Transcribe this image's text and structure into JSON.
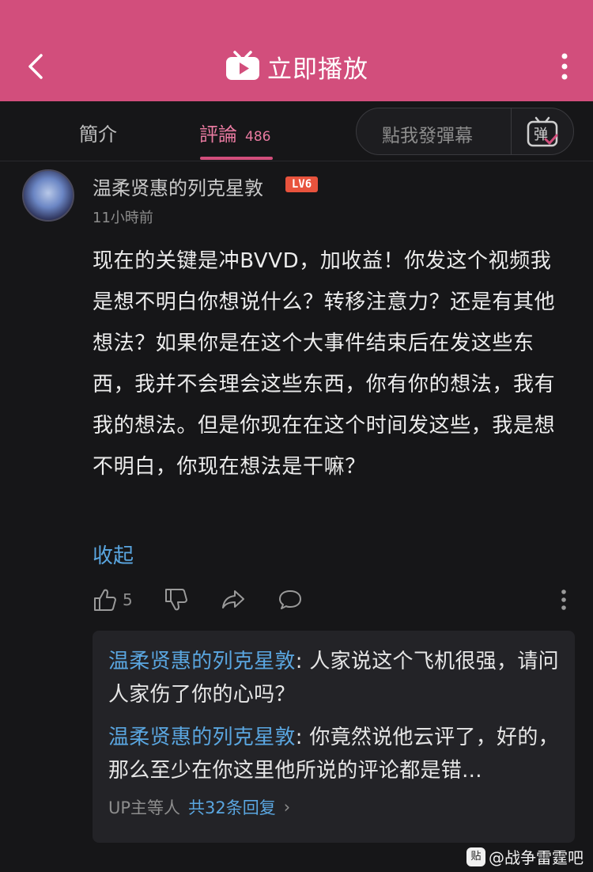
{
  "header": {
    "title": "立即播放",
    "bg_color": "#d24e7c",
    "back_icon": "chevron-left-icon",
    "tv_icon": "tv-play-icon",
    "more_icon": "vertical-dots-icon"
  },
  "tabs": {
    "intro_label": "簡介",
    "comments_label": "評論",
    "comments_count": "486",
    "active": "comments"
  },
  "danmaku": {
    "placeholder": "點我發彈幕",
    "icon": "danmaku-toggle-icon",
    "icon_label": "弹"
  },
  "comment": {
    "username": "温柔贤惠的列克星敦",
    "level": "LV6",
    "time": "11小時前",
    "body": "现在的关键是冲BVVD，加收益！你发这个视频我是想不明白你想说什么？转移注意力？还是有其他想法？如果你是在这个大事件结束后在发这些东西，我并不会理会这些东西，你有你的想法，我有我的想法。但是你现在在这个时间发这些，我是想不明白，你现在想法是干嘛？",
    "collapse_label": "收起",
    "like_count": "5"
  },
  "replies": {
    "items": [
      {
        "name": "温柔贤惠的列克星敦",
        "text": ": 人家说这个飞机很强，请问人家伤了你的心吗？"
      },
      {
        "name": "温柔贤惠的列克星敦",
        "text": ": 你竟然说他云评了，好的，那么至少在你这里他所说的评论都是错..."
      }
    ],
    "more_prefix": "UP主等人",
    "more_link": "共32条回复",
    "chevron": "›"
  },
  "watermark": {
    "icon_label": "贴",
    "text": "@战争雷霆吧"
  }
}
